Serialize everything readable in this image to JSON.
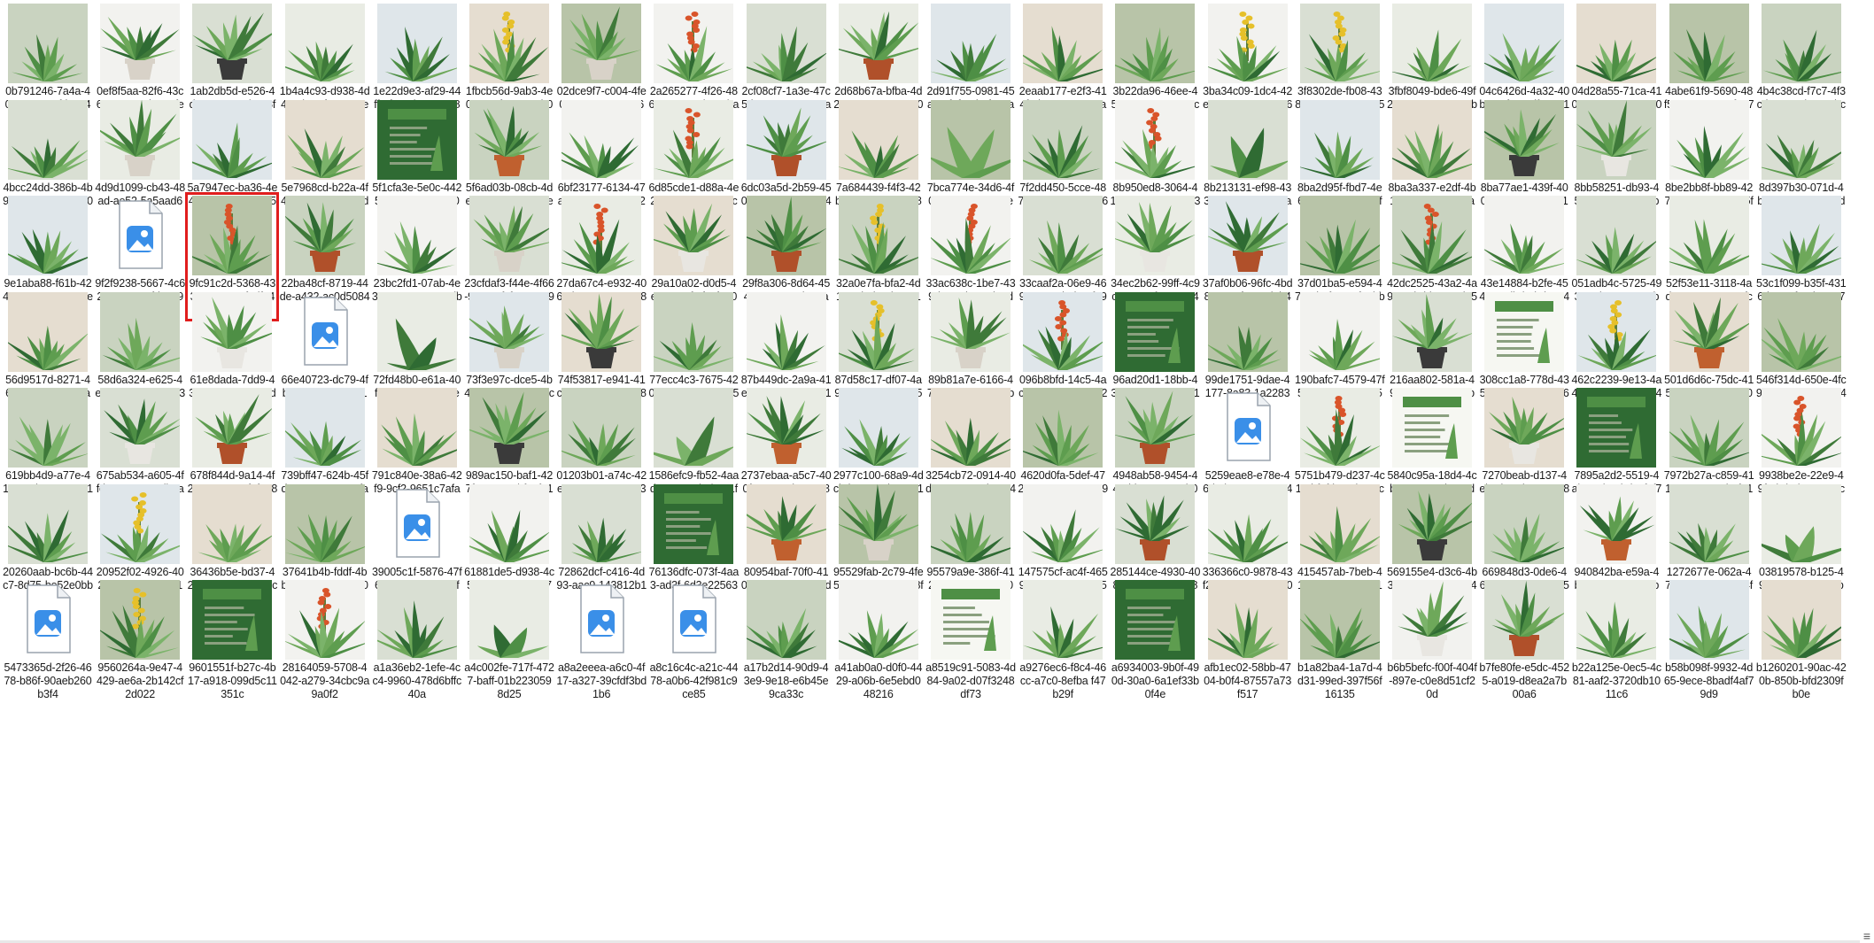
{
  "explorer": {
    "view": "large-icons",
    "selected_index": 42,
    "files": [
      {
        "label": "0b791246-7a4a-4037-9acc-efda6c4b3fef",
        "thumb": "plant"
      },
      {
        "label": "0ef8f5aa-82f6-43c6-ae0e-59d4835fe936",
        "thumb": "potted"
      },
      {
        "label": "1ab2db5d-e526-4da6-8a1c-1cb208fe0b7d",
        "thumb": "potted"
      },
      {
        "label": "1b4a4c93-d938-4d43-9b18-fe32458e8592",
        "thumb": "plant"
      },
      {
        "label": "1e22d9e3-af29-44ff-afa7-3bc5966c88d1",
        "thumb": "plant"
      },
      {
        "label": "1fbcb56d-9ab3-4e01-99af-96c860b02f20",
        "thumb": "flower"
      },
      {
        "label": "02dce9f7-c004-4fe0-97a0-e38604264a56",
        "thumb": "potted"
      },
      {
        "label": "2a265277-4f26-4868-ac58-1eb4e0ba04dd",
        "thumb": "flower"
      },
      {
        "label": "2cf08cf7-1a3e-47c5-b91c-178c957ea10d",
        "thumb": "plant"
      },
      {
        "label": "2d68b67a-bfba-4d2c-9c86-049462409a04",
        "thumb": "potted"
      },
      {
        "label": "2d91f755-0981-45a2-9faf-23b1f65ca5c5",
        "thumb": "plant"
      },
      {
        "label": "2eaab177-e2f3-414f-abe8-1c3524ca2a11",
        "thumb": "plant"
      },
      {
        "label": "3b22da96-46ee-4596-917c-218c4cc6a81b",
        "thumb": "plant"
      },
      {
        "label": "3ba34c09-1dc4-42ec-92e4-5192ace63fcc",
        "thumb": "flower"
      },
      {
        "label": "3f8302de-fb08-438a-a16e-791cc635ac73",
        "thumb": "flower"
      },
      {
        "label": "3fbf8049-bde6-49f2-9c5e-57317846bc9d",
        "thumb": "plant"
      },
      {
        "label": "04c6426d-4a32-40bc-80f2-6edfa04613d7",
        "thumb": "plant"
      },
      {
        "label": "04d28a55-71ca-4105-8a47-537c5990f664",
        "thumb": "plant"
      },
      {
        "label": "4abe61f9-5690-48f5-a166-478c7f0776e2",
        "thumb": "plant"
      },
      {
        "label": "4b4c38cd-f7c7-4f3c-bca4-4eb7552bcb9",
        "thumb": "plant"
      },
      {
        "label": "4bcc24dd-386b-4b99-927d-d8960cb0345a",
        "thumb": "plant"
      },
      {
        "label": "4d9d1099-cb43-48ad-ae52-5a5aad63cb72",
        "thumb": "potted"
      },
      {
        "label": "5a7947ec-ba36-4e4f-b1aa-951bd1d53ca3",
        "thumb": "plant"
      },
      {
        "label": "5e7968cd-b22a-4f4f-b5de-b6b9358d52ae",
        "thumb": "plant"
      },
      {
        "label": "5f1cfa3e-5e0c-4425-ae35-072191a0369f",
        "thumb": "book"
      },
      {
        "label": "5f6ad03b-08cb-4def-8da6-5768a16e73e6",
        "thumb": "potted"
      },
      {
        "label": "6bf23177-6134-47a6-ba64-f7e53042cb80",
        "thumb": "plant"
      },
      {
        "label": "6d85cde1-d88a-4e20-91a4-afe929dc51d",
        "thumb": "flower"
      },
      {
        "label": "6dc03a5d-2b59-4508-8919-c521e744dcac",
        "thumb": "potted"
      },
      {
        "label": "7a684439-f4f3-42ba-a1b9-3ce5fc085e6f",
        "thumb": "plant"
      },
      {
        "label": "7bca774e-34d6-4f06-bb58-9a2266e2cb8f",
        "thumb": "leaf"
      },
      {
        "label": "7f2dd450-5cce-487e-a39b-d4bce0b66ae0",
        "thumb": "plant"
      },
      {
        "label": "8b950ed8-3064-41db-bd94-a43c883025ea",
        "thumb": "flower"
      },
      {
        "label": "8b213131-ef98-4335-92f9-6385271a7cb15",
        "thumb": "leaf"
      },
      {
        "label": "8ba2d95f-fbd7-4e67-985e-d96b48ff3675",
        "thumb": "plant"
      },
      {
        "label": "8ba3a337-e2df-4b18-8168-6a432aa9dab0",
        "thumb": "plant"
      },
      {
        "label": "8ba77ae1-439f-4004-858d-40f243a16e38",
        "thumb": "potted"
      },
      {
        "label": "8bb58251-db93-4504-909b-1529eb90c336",
        "thumb": "potted"
      },
      {
        "label": "8be2bb8f-bb89-4273-9d64-1cc42cf5fabf",
        "thumb": "plant"
      },
      {
        "label": "8d397b30-071d-4ba2-ade9-7f1524db4c49",
        "thumb": "plant"
      },
      {
        "label": "9e1aba88-f61b-4246-83c5-739a485ef30e",
        "thumb": "plant"
      },
      {
        "label": "9f2f9238-5667-4c62-8a87-2c4fd7c09ca8",
        "thumb": "file"
      },
      {
        "label": "9fc91c2d-5368-4333-aa85-48f7df649420",
        "thumb": "flower"
      },
      {
        "label": "22ba48cf-8719-44de-a432-ac0d5084c3b7",
        "thumb": "potted"
      },
      {
        "label": "23bc2fd1-07ab-4e35-8c5a-1a1732dbecd4",
        "thumb": "plant"
      },
      {
        "label": "23cfdaf3-f44e-4f66-94a4-7fcf09412591",
        "thumb": "potted"
      },
      {
        "label": "27da67c4-e932-4060-b396-430700c89afa",
        "thumb": "flower"
      },
      {
        "label": "29a10a02-d0d5-4e63-83ef-cfacf540b979",
        "thumb": "potted"
      },
      {
        "label": "29f8a306-8d64-4544-8240-13daaeaa0aad",
        "thumb": "potted"
      },
      {
        "label": "32a0e7fa-bfa2-4d10-9d9d-24be52182001",
        "thumb": "flower"
      },
      {
        "label": "33ac638c-1be7-439d-920d-a07d42d5cedd",
        "thumb": "flower"
      },
      {
        "label": "33caaf2a-06e9-4693-a929-b8be7fa9a60d",
        "thumb": "plant"
      },
      {
        "label": "34ec2b62-99ff-4c9c-8401-7f32e05e4298",
        "thumb": "potted"
      },
      {
        "label": "37af0b06-96fc-4bd8-8110-f1519d0b49fe",
        "thumb": "potted"
      },
      {
        "label": "37d01ba5-e594-47a4-bafc-509f49bbbec9",
        "thumb": "plant"
      },
      {
        "label": "42dc2525-43a2-4a94-9cbd-b2a63de55315",
        "thumb": "flower"
      },
      {
        "label": "43e14884-b2fe-4543-8adb-b8bdca4416e3",
        "thumb": "plant"
      },
      {
        "label": "051adb4c-5725-4935-8d10-390988b81ce7",
        "thumb": "plant"
      },
      {
        "label": "52f53e11-3118-4ada-9638-2630e8fced87",
        "thumb": "plant"
      },
      {
        "label": "53c1f099-b35f-4316-b455-f64d4a4472d9",
        "thumb": "plant"
      },
      {
        "label": "56d9517d-8271-4637-8024-20a63aafca42",
        "thumb": "plant"
      },
      {
        "label": "58d6a324-e625-4ea6-8b0c-87d4943bdf3e",
        "thumb": "plant"
      },
      {
        "label": "61e8dada-7dd9-435f-a50d-37c315d43eb9",
        "thumb": "potted"
      },
      {
        "label": "66e40723-dc79-4fb8-95d5-43582d10b9c4",
        "thumb": "file"
      },
      {
        "label": "72fd48b0-e61a-40fc-8a83-c1113bae52c2",
        "thumb": "leaf"
      },
      {
        "label": "73f3e97c-dce5-4b4f-9615-716453afcf3f",
        "thumb": "potted"
      },
      {
        "label": "74f53817-e941-41c0-b9ec-aa0bd7080a1d",
        "thumb": "potted"
      },
      {
        "label": "77ecc4c3-7675-4208-89c6-a920b5658174",
        "thumb": "plant"
      },
      {
        "label": "87b449dc-2a9a-41e5-bf4d-f569eedc1782",
        "thumb": "plant"
      },
      {
        "label": "87d58c17-df07-4a96-8f98-ee272475141f",
        "thumb": "flower"
      },
      {
        "label": "89b81a7e-6166-4792-9a56-c080f4b9e4e2",
        "thumb": "potted"
      },
      {
        "label": "096b8bfd-14c5-4ac4-9284-efcc759f2483",
        "thumb": "flower"
      },
      {
        "label": "96ad20d1-18bb-43ac-84a7-2611c51f0ee6",
        "thumb": "book"
      },
      {
        "label": "99de1751-9dae-4177-8a83-1a22833cab2b",
        "thumb": "plant"
      },
      {
        "label": "190bafc7-4579-47f5-a012-b563bad5333a",
        "thumb": "plant"
      },
      {
        "label": "216aa802-581a-4974-bb7e-dad42b97ec87",
        "thumb": "potted"
      },
      {
        "label": "308cc1a8-778d-4354-b72f-3cf1c4e96f70",
        "thumb": "book"
      },
      {
        "label": "462c2239-9e13-4a49-8acb-4b58bb14f363",
        "thumb": "flower"
      },
      {
        "label": "501d6d6c-75dc-415e-a4d6-b62fec104702",
        "thumb": "potted"
      },
      {
        "label": "546f314d-650e-4fc9-b6f8-1ff1a0f8044b",
        "thumb": "plant"
      },
      {
        "label": "619bb4d9-a77e-415c-90ba-a2528e11008a",
        "thumb": "plant"
      },
      {
        "label": "675ab534-a605-4ffd-a138-aa93db9a28cf",
        "thumb": "potted"
      },
      {
        "label": "678f844d-9a14-4f27-8aa3-5c7f3f408dcb",
        "thumb": "potted"
      },
      {
        "label": "739bff47-624b-45fd-8373-1c0e466fa1e4",
        "thumb": "plant"
      },
      {
        "label": "791c840e-38a6-42f9-9cf2-9651c7afac15",
        "thumb": "plant"
      },
      {
        "label": "989ac150-baf1-427f-9712-52bf5ef41c71",
        "thumb": "potted"
      },
      {
        "label": "01203b01-a74c-42ec-a106-25ce4c93af6b",
        "thumb": "plant"
      },
      {
        "label": "1586efc9-fb52-4aad-9714-03b5b4a1f786",
        "thumb": "leaf"
      },
      {
        "label": "2737ebaa-a5c7-400f-a136-ad4ec02828a5",
        "thumb": "potted"
      },
      {
        "label": "2977c100-68a9-4dcb-b389-64b53201612a",
        "thumb": "plant"
      },
      {
        "label": "3254cb72-0914-40d0-91a8-a55ba8c4f704",
        "thumb": "plant"
      },
      {
        "label": "4620d0fa-5def-4727-a2ac-10334299c0ae",
        "thumb": "plant"
      },
      {
        "label": "4948ab58-9454-445d-ba94-6375b01e10e1",
        "thumb": "potted"
      },
      {
        "label": "5259eae8-e78e-46d6-b9c4-75ca964cb45d",
        "thumb": "file"
      },
      {
        "label": "5751b479-d237-4c19-bf2f-b1c5b8c3c515",
        "thumb": "flower"
      },
      {
        "label": "5840c95a-18d4-4cb1-9858-56b827d7b937",
        "thumb": "book"
      },
      {
        "label": "7270beab-d137-4eb7-b57d-080ac6804b93",
        "thumb": "potted"
      },
      {
        "label": "7895a2d2-5519-4ab5-8d16-bdcaf3f7ca3c",
        "thumb": "book"
      },
      {
        "label": "7972b27a-c859-4116-9870-817b1f01fe7f",
        "thumb": "plant"
      },
      {
        "label": "9938be2e-22e9-49f4-bd9d-9a5054c55378",
        "thumb": "flower"
      },
      {
        "label": "20260aab-bc6b-44c7-8d75-be52e0bbc7f8",
        "thumb": "plant"
      },
      {
        "label": "20952f02-4926-4023-a18d-84a5a7108204",
        "thumb": "flower"
      },
      {
        "label": "36436b5e-bd37-4223-b9fb-4f9a638ca06d",
        "thumb": "plant"
      },
      {
        "label": "37641b4b-fddf-4bb6-97f8-d90cb1203fdd",
        "thumb": "plant"
      },
      {
        "label": "39005c1f-5876-47f6-8f88-79219682f399",
        "thumb": "file"
      },
      {
        "label": "61881de5-d938-4c51-a886-a00349755cc1c",
        "thumb": "plant"
      },
      {
        "label": "72862dcf-c416-4d93-aac9-143812b1b92e",
        "thumb": "plant"
      },
      {
        "label": "76136dfc-073f-4aa3-ad3f-6d3e22563d376",
        "thumb": "book"
      },
      {
        "label": "80954baf-70f0-410f-88ad-9625cfd9d95c",
        "thumb": "potted"
      },
      {
        "label": "95529fab-2c79-4fe5-888d-89c0670f8f299",
        "thumb": "potted"
      },
      {
        "label": "95579a9e-386f-412a-8dbd-1be62e01c702",
        "thumb": "plant"
      },
      {
        "label": "147575cf-ac4f-4659-846d-fdd46ad053d7",
        "thumb": "plant"
      },
      {
        "label": "285144ce-4930-4084-be55-8848ba812fa7",
        "thumb": "potted"
      },
      {
        "label": "336366c0-9878-43f2-8fca-aa5aa2ae0e9b",
        "thumb": "plant"
      },
      {
        "label": "415457ab-7beb-4159-a6bb-d619a15c0759",
        "thumb": "plant"
      },
      {
        "label": "569155e4-d3c6-4b3d-becf-b19fbaac410f",
        "thumb": "potted"
      },
      {
        "label": "669848d3-0de6-46dd-a134-2c6c65582a56",
        "thumb": "plant"
      },
      {
        "label": "940842ba-e59a-4bee-b19a-0f8bf8b72ea5",
        "thumb": "potted"
      },
      {
        "label": "1272677e-062a-470e-bd8e-4b9834ff37da",
        "thumb": "plant"
      },
      {
        "label": "03819578-b125-4982-b069-9a4e6b86132e",
        "thumb": "leaf"
      },
      {
        "label": "5473365d-2f26-4678-b86f-90aeb260b3f4",
        "thumb": "file"
      },
      {
        "label": "9560264a-9e47-4429-ae6a-2b142cf2d022",
        "thumb": "flower"
      },
      {
        "label": "9601551f-b27c-4b17-a918-099d5c11351c",
        "thumb": "book"
      },
      {
        "label": "28164059-5708-4042-a279-34cbc9a9a0f2",
        "thumb": "flower"
      },
      {
        "label": "a1a36eb2-1efe-4cc4-9960-478d6bffc40a",
        "thumb": "plant"
      },
      {
        "label": "a4c002fe-717f-4727-baff-01b2230598d25",
        "thumb": "leaf"
      },
      {
        "label": "a8a2eeea-a6c0-4f17-a327-39cfdf3bd1b6",
        "thumb": "file"
      },
      {
        "label": "a8c16c4c-a21c-4478-a0b6-42f981c9ce85",
        "thumb": "file"
      },
      {
        "label": "a17b2d14-90d9-43e9-9e18-e6b45e9ca33c",
        "thumb": "plant"
      },
      {
        "label": "a41ab0a0-d0f0-4429-a06b-6e5ebd048216",
        "thumb": "plant"
      },
      {
        "label": "a8519c91-5083-4d84-9a02-d07f3248df73",
        "thumb": "book"
      },
      {
        "label": "a9276ec6-f8c4-46cc-a7c0-8efba f47b29f",
        "thumb": "plant"
      },
      {
        "label": "a6934003-9b0f-490d-30a0-6a1ef33b0f4e",
        "thumb": "book"
      },
      {
        "label": "afb1ec02-58bb-4704-b0f4-87557a73f517",
        "thumb": "plant"
      },
      {
        "label": "b1a82ba4-1a7d-4d31-99ed-397f56f16135",
        "thumb": "plant"
      },
      {
        "label": "b6b5befc-f00f-404f-897e-c0e8d51cf20d",
        "thumb": "potted"
      },
      {
        "label": "b7fe80fe-e5dc-4525-a019-d8ea2a7b00a6",
        "thumb": "potted"
      },
      {
        "label": "b22a125e-0ec5-4c81-aaf2-3720db1011c6",
        "thumb": "plant"
      },
      {
        "label": "b58b098f-9932-4d65-9ece-8badf4af79d9",
        "thumb": "plant"
      },
      {
        "label": "b1260201-90ac-420b-850b-bfd2309fb0e",
        "thumb": "plant"
      }
    ]
  },
  "colors": {
    "selection_outline": "#e01d1d",
    "caption_text": "#1a1a1a",
    "file_icon_blue": "#3a8fe8"
  }
}
